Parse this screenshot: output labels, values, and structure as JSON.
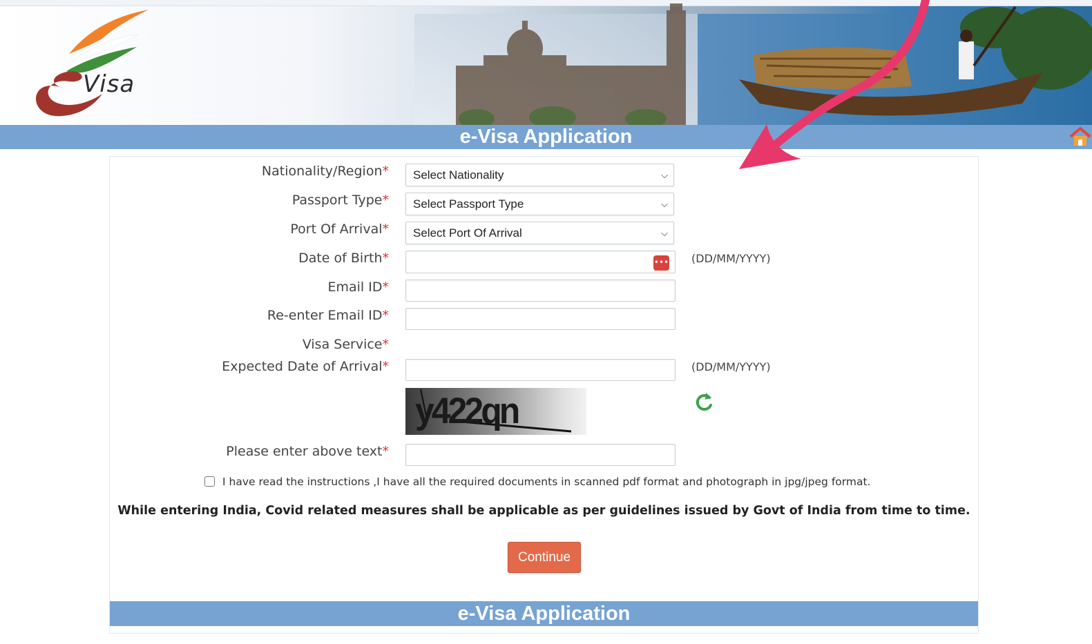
{
  "header": {
    "logo_text": "Visa",
    "title": "e-Visa Application"
  },
  "form": {
    "nationality": {
      "label": "Nationality/Region",
      "required_mark": "*",
      "value": "Select Nationality"
    },
    "passport_type": {
      "label": "Passport Type",
      "required_mark": "*",
      "value": "Select Passport Type"
    },
    "port_of_arrival": {
      "label": "Port Of Arrival",
      "required_mark": "*",
      "value": "Select Port Of Arrival"
    },
    "date_of_birth": {
      "label": "Date of Birth",
      "required_mark": "*",
      "value": "",
      "format_hint": "(DD/MM/YYYY)"
    },
    "email": {
      "label": "Email ID",
      "required_mark": "*",
      "value": ""
    },
    "email_confirm": {
      "label": "Re-enter Email ID",
      "required_mark": "*",
      "value": ""
    },
    "visa_service": {
      "label": "Visa Service",
      "required_mark": "*"
    },
    "expected_arrival": {
      "label": "Expected Date of Arrival",
      "required_mark": "*",
      "value": "",
      "format_hint": "(DD/MM/YYYY)"
    },
    "captcha": {
      "image_text": "y422qn",
      "label": "Please enter above text",
      "required_mark": "*",
      "value": ""
    },
    "agreement": {
      "checked": false,
      "text": "I have read the instructions ,I have all the required documents in scanned pdf format and photograph in jpg/jpeg format."
    },
    "covid_note": "While entering India, Covid related measures shall be applicable as per guidelines issued by Govt of India from time to time.",
    "continue_label": "Continue"
  },
  "footer": {
    "title": "e-Visa Application"
  },
  "icons": {
    "select_chevron": "chevron-down-icon",
    "calendar": "calendar-icon",
    "refresh": "refresh-icon",
    "home": "home-icon"
  },
  "colors": {
    "title_bar": "#76a3d2",
    "continue_button": "#e26a4a",
    "required_mark": "#e0303a",
    "refresh_icon": "#3aa34a",
    "annotation_arrow": "#e8386b"
  }
}
